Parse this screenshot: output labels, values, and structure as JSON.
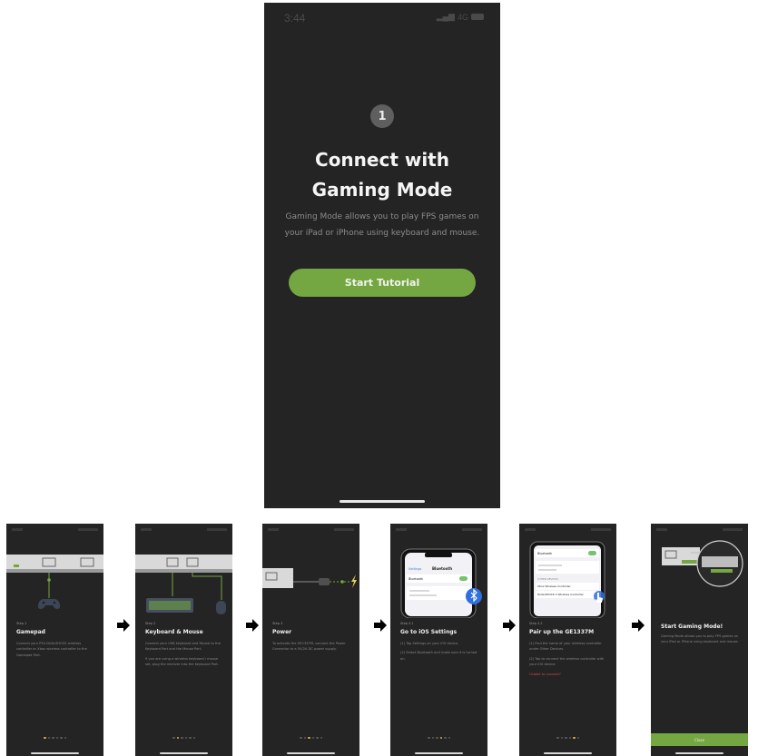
{
  "main": {
    "status_time": "3:44",
    "status_network": "4G",
    "step_number": "1",
    "title_line1": "Connect with",
    "title_line2": "Gaming Mode",
    "desc_line1": "Gaming Mode allows you to play FPS games on",
    "desc_line2": "your iPad or iPhone using keyboard and mouse.",
    "button_label": "Start Tutorial"
  },
  "steps": [
    {
      "step_label": "Step 1",
      "title": "Gamepad",
      "body": [
        "Connect your PS4 DUALSHOCK wireless controller or Xbox wireless controller to the Gamepad Port."
      ],
      "active_dot": 1
    },
    {
      "step_label": "Step 2",
      "title": "Keyboard & Mouse",
      "body": [
        "Connect your USB keyboard and Mouse to the Keyboard Port and the Mouse Port.",
        "If you are using a wireless keyboard / mouse set, plug the receiver into the Keyboard Port."
      ],
      "active_dot": 2
    },
    {
      "step_label": "Step 3",
      "title": "Power",
      "body": [
        "To activate the GE1337M, connect the Power Connector to a 5V/2A DC power supply."
      ],
      "active_dot": 3
    },
    {
      "step_label": "Step 4.1",
      "title": "Go to iOS Settings",
      "body": [
        "(1) Tap Settings on your iOS device.",
        "(2) Select Bluetooth and make sure it is turned on."
      ],
      "active_dot": 4
    },
    {
      "step_label": "Step 4.2",
      "title": "Pair up the GE1337M",
      "body": [
        "(1) Find the name of your wireless controller under Other Devices.",
        "(2) Tap to connect the wireless controller with your iOS device."
      ],
      "warning": "Unable to connect?",
      "active_dot": 5
    },
    {
      "step_label": "",
      "title": "Start Gaming Mode!",
      "body": [
        "Gaming Mode allows you to play FPS games on your iPad or iPhone using keyboard and mouse."
      ],
      "close_label": "Close"
    }
  ],
  "mini_screens": {
    "settings_back": "Settings",
    "settings_title": "Bluetooth",
    "settings_row": "Bluetooth",
    "pair_row1": "Bluetooth",
    "pair_section": "OTHER DEVICES",
    "pair_row2": "Xbox Wireless Controller",
    "pair_row3": "DUALSHOCK 4 Wireless Controller"
  },
  "colors": {
    "accent_green": "#74a642",
    "screen_bg": "#242424",
    "dot_active": "#d2b43a",
    "warning": "#c8523c"
  },
  "icons": [
    "arrow-right-icon",
    "bluetooth-icon",
    "gamepad-icon",
    "keyboard-icon",
    "mouse-icon",
    "power-plug-icon",
    "lightning-icon",
    "hand-tap-icon"
  ]
}
